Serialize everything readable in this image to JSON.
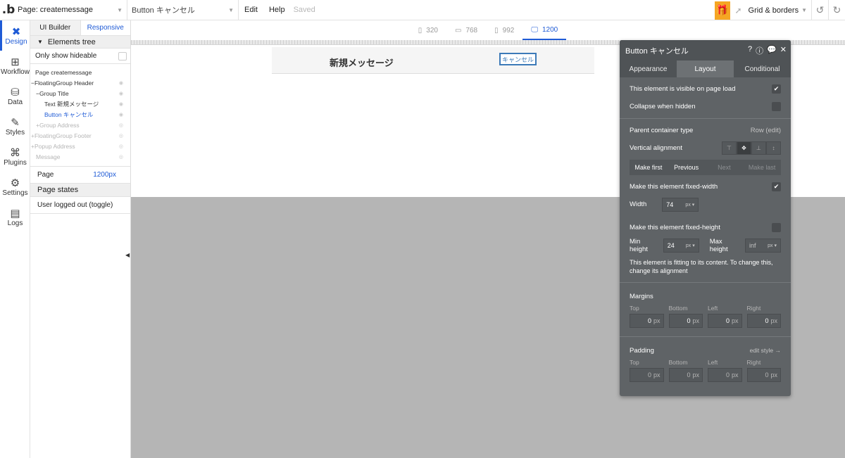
{
  "topbar": {
    "logo": ".b",
    "page_label": "Page: createmessage",
    "element_label": "Button キャンセル",
    "menu_edit": "Edit",
    "menu_help": "Help",
    "saved": "Saved",
    "grid_borders": "Grid & borders"
  },
  "rail": [
    {
      "label": "Design",
      "icon": "design-icon"
    },
    {
      "label": "Workflow",
      "icon": "workflow-icon"
    },
    {
      "label": "Data",
      "icon": "data-icon"
    },
    {
      "label": "Styles",
      "icon": "styles-icon"
    },
    {
      "label": "Plugins",
      "icon": "plugins-icon"
    },
    {
      "label": "Settings",
      "icon": "gear-icon"
    },
    {
      "label": "Logs",
      "icon": "logs-icon"
    }
  ],
  "panel": {
    "tab_ui_builder": "UI Builder",
    "tab_responsive": "Responsive",
    "elements_tree": "Elements tree",
    "only_show_hideable": "Only show hideable",
    "tree": [
      {
        "label": "Page createmessage"
      },
      {
        "label": "FloatingGroup Header"
      },
      {
        "label": "Group Title"
      },
      {
        "label": "Text 新規メッセージ"
      },
      {
        "label": "Button キャンセル"
      },
      {
        "label": "Group Address"
      },
      {
        "label": "FloatingGroup Footer"
      },
      {
        "label": "Popup Address"
      },
      {
        "label": "Message"
      }
    ],
    "page_label": "Page",
    "page_value": "1200px",
    "page_states": "Page states",
    "state_item": "User logged out (toggle)"
  },
  "breakpoints": [
    {
      "label": "320"
    },
    {
      "label": "768"
    },
    {
      "label": "992"
    },
    {
      "label": "1200"
    }
  ],
  "canvas": {
    "title": "新規メッセージ",
    "button": "キャンセル"
  },
  "props": {
    "title": "Button キャンセル",
    "tabs": [
      "Appearance",
      "Layout",
      "Conditional"
    ],
    "visible_on_load": "This element is visible on page load",
    "collapse_hidden": "Collapse when hidden",
    "parent_type_label": "Parent container type",
    "parent_type_value": "Row (edit)",
    "vertical_alignment": "Vertical alignment",
    "order_buttons": [
      "Make first",
      "Previous",
      "Next",
      "Make last"
    ],
    "fixed_width": "Make this element fixed-width",
    "width_label": "Width",
    "width_value": "74",
    "unit": "px",
    "fixed_height": "Make this element fixed-height",
    "min_height_label": "Min height",
    "min_height_value": "24",
    "max_height_label": "Max height",
    "max_height_value": "inf",
    "fitting_note": "This element is fitting to its content. To change this, change its alignment",
    "margins": "Margins",
    "padding": "Padding",
    "edit_style": "edit style →",
    "sides": [
      "Top",
      "Bottom",
      "Left",
      "Right"
    ],
    "margin_values": [
      "0",
      "0",
      "0",
      "0"
    ],
    "padding_values": [
      "0",
      "0",
      "0",
      "0"
    ],
    "px": "px"
  }
}
